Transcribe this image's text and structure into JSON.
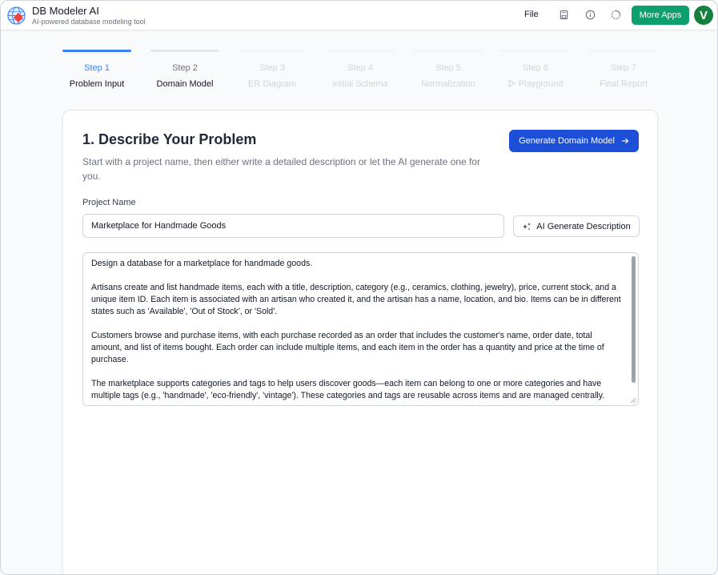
{
  "app": {
    "title": "DB Modeler AI",
    "subtitle": "AI-powered database modeling tool"
  },
  "header": {
    "file_label": "File",
    "more_apps_label": "More Apps",
    "avatar_initial": "V",
    "icons": [
      "save-icon",
      "info-icon",
      "theme-icon"
    ],
    "brand_color": "#0e9f6e"
  },
  "steps": [
    {
      "num": "Step 1",
      "label": "Problem Input",
      "state": "active"
    },
    {
      "num": "Step 2",
      "label": "Domain Model",
      "state": "done"
    },
    {
      "num": "Step 3",
      "label": "ER Diagram",
      "state": "disabled"
    },
    {
      "num": "Step 4",
      "label": "Initial Schema",
      "state": "disabled"
    },
    {
      "num": "Step 5",
      "label": "Normalization",
      "state": "disabled"
    },
    {
      "num": "Step 6",
      "label": "Playground",
      "state": "disabled"
    },
    {
      "num": "Step 7",
      "label": "Final Report",
      "state": "disabled"
    }
  ],
  "card": {
    "title": "1. Describe Your Problem",
    "description": "Start with a project name, then either write a detailed description or let the AI generate one for you.",
    "generate_button": "Generate Domain Model",
    "project_name_label": "Project Name",
    "project_name_value": "Marketplace for Handmade Goods",
    "ai_button": "AI Generate Description",
    "problem_text": "Design a database for a marketplace for handmade goods.\n\nArtisans create and list handmade items, each with a title, description, category (e.g., ceramics, clothing, jewelry), price, current stock, and a unique item ID. Each item is associated with an artisan who created it, and the artisan has a name, location, and bio. Items can be in different states such as 'Available', 'Out of Stock', or 'Sold'.\n\nCustomers browse and purchase items, with each purchase recorded as an order that includes the customer's name, order date, total amount, and list of items bought. Each order can include multiple items, and each item in the order has a quantity and price at the time of purchase.\n\nThe marketplace supports categories and tags to help users discover goods—each item can belong to one or more categories and have multiple tags (e.g., 'handmade', 'eco-friendly', 'vintage'). These categories and tags are reusable across items and are managed centrally.",
    "accent_color": "#1d4ed8"
  }
}
